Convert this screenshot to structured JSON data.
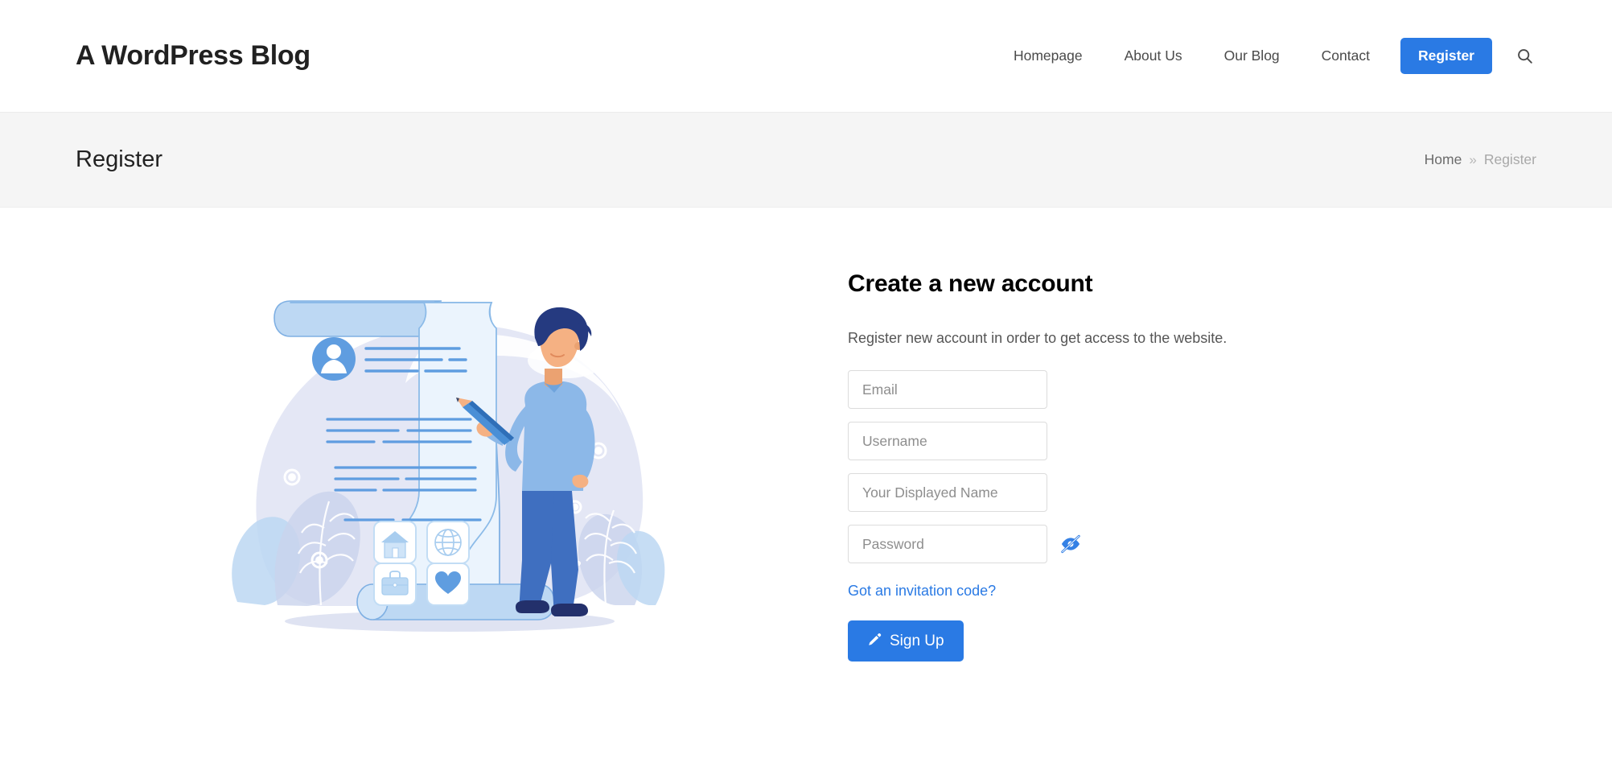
{
  "header": {
    "site_title": "A WordPress Blog",
    "nav_items": [
      {
        "label": "Homepage"
      },
      {
        "label": "About Us"
      },
      {
        "label": "Our Blog"
      },
      {
        "label": "Contact"
      }
    ],
    "cta_label": "Register",
    "search_icon": "search-icon"
  },
  "page_band": {
    "title": "Register",
    "breadcrumb": {
      "home": "Home",
      "separator": "»",
      "current": "Register"
    }
  },
  "form": {
    "heading": "Create a new account",
    "subtitle": "Register new account in order to get access to the website.",
    "fields": [
      {
        "name": "email",
        "placeholder": "Email",
        "value": "",
        "type": "text"
      },
      {
        "name": "username",
        "placeholder": "Username",
        "value": "",
        "type": "text"
      },
      {
        "name": "display_name",
        "placeholder": "Your Displayed Name",
        "value": "",
        "type": "text"
      },
      {
        "name": "password",
        "placeholder": "Password",
        "value": "",
        "type": "password"
      }
    ],
    "password_toggle_icon": "eye-slash-icon",
    "password_visible": false,
    "invitation_link": "Got an invitation code?",
    "submit_label": "Sign Up",
    "submit_icon": "pencil-icon"
  },
  "illustration": {
    "name": "registration-scroll-illustration",
    "alt": "Man with pencil next to a long registration form scroll",
    "tile_icons": [
      "house-icon",
      "globe-icon",
      "briefcase-icon",
      "heart-icon"
    ],
    "avatar_icon": "user-avatar-icon"
  },
  "colors": {
    "accent": "#2a7ae4",
    "band_bg": "#f5f5f5",
    "text_dark": "#222222",
    "text_muted": "#8e8e8e",
    "border": "#dcdcdc",
    "illus_light": "#e6f0fb",
    "illus_mid": "#8cb8e8",
    "illus_deep": "#3f6fc0",
    "illus_bg": "#e4e7f5",
    "skin": "#f5b183",
    "hair": "#253a80"
  }
}
